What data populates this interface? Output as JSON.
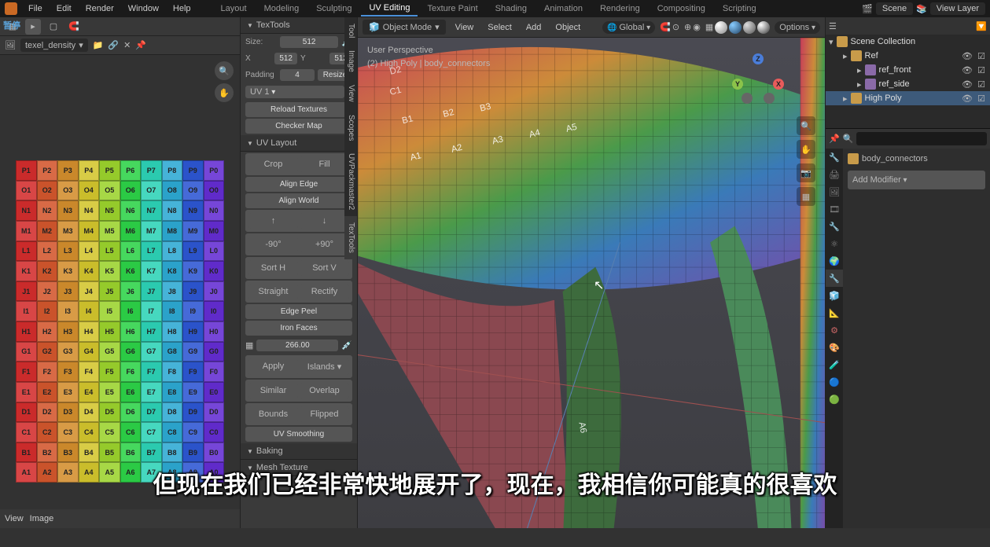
{
  "top_menu": {
    "items": [
      "File",
      "Edit",
      "Render",
      "Window",
      "Help"
    ],
    "workspaces": [
      "Layout",
      "Modeling",
      "Sculpting",
      "UV Editing",
      "Texture Paint",
      "Shading",
      "Animation",
      "Rendering",
      "Compositing",
      "Scripting"
    ],
    "active_workspace": "UV Editing",
    "scene_label": "Scene",
    "layer_label": "View Layer"
  },
  "uv_editor": {
    "dropdown": "texel_density",
    "footer": {
      "items": [
        "View",
        "Image"
      ]
    },
    "nav_icons": [
      "zoom-icon",
      "pan-hand-icon"
    ]
  },
  "textools": {
    "title": "TexTools",
    "size_label": "Size:",
    "size": "512",
    "x_label": "X",
    "x": "512",
    "y_label": "Y",
    "y": "512",
    "padding_label": "Padding",
    "padding": "4",
    "resize": "Resize",
    "uv_channel": "UV 1",
    "reload": "Reload Textures",
    "checker": "Checker Map",
    "uv_layout": "UV Layout",
    "crop": "Crop",
    "fill": "Fill",
    "align_edge": "Align Edge",
    "align_world": "Align World",
    "rot_l": "-90°",
    "rot_r": "+90°",
    "sort_h": "Sort H",
    "sort_v": "Sort V",
    "straight": "Straight",
    "rectify": "Rectify",
    "edge_peel": "Edge Peel",
    "iron_faces": "Iron Faces",
    "density_val": "266.00",
    "apply": "Apply",
    "islands": "Islands",
    "similar": "Similar",
    "overlap": "Overlap",
    "bounds": "Bounds",
    "flipped": "Flipped",
    "smoothing": "UV Smoothing",
    "baking": "Baking",
    "mesh_texture": "Mesh Texture",
    "side_tabs": [
      "Tool",
      "Image",
      "View",
      "Scopes",
      "UVPackmaster2",
      "TexTools"
    ]
  },
  "viewport": {
    "mode": "Object Mode",
    "menus": [
      "View",
      "Select",
      "Add",
      "Object"
    ],
    "global": "Global",
    "options": "Options",
    "overlay_line1": "User Perspective",
    "overlay_line2": "(2) High Poly | body_connectors",
    "gizmo": {
      "z": "Z",
      "y": "Y",
      "x": "X"
    }
  },
  "outliner": {
    "title": "Scene Collection",
    "items": [
      {
        "name": "Ref",
        "indent": 1,
        "type": "collection"
      },
      {
        "name": "ref_front",
        "indent": 2,
        "type": "image"
      },
      {
        "name": "ref_side",
        "indent": 2,
        "type": "image"
      },
      {
        "name": "High Poly",
        "indent": 1,
        "type": "collection",
        "active": true
      }
    ]
  },
  "properties": {
    "search_placeholder": "",
    "object": "body_connectors",
    "add_modifier": "Add Modifier",
    "tab_colors": [
      "#888",
      "#888",
      "#888",
      "#888",
      "#cc7a3a",
      "#888",
      "#888",
      "#4a90d9",
      "#888",
      "#888",
      "#c66",
      "#5ac",
      "#888",
      "#888",
      "#888"
    ]
  },
  "checker_rows": [
    "P",
    "O",
    "N",
    "M",
    "L",
    "K",
    "J",
    "I",
    "H",
    "G",
    "F",
    "E",
    "D",
    "C",
    "B",
    "A"
  ],
  "checker_cols": [
    "1",
    "2",
    "3",
    "4",
    "5",
    "6",
    "7",
    "8",
    "9",
    "0"
  ],
  "subtitle": "但现在我们已经非常快地展开了，现在，我相信你可能真的很喜欢",
  "pause_label": "暂停"
}
